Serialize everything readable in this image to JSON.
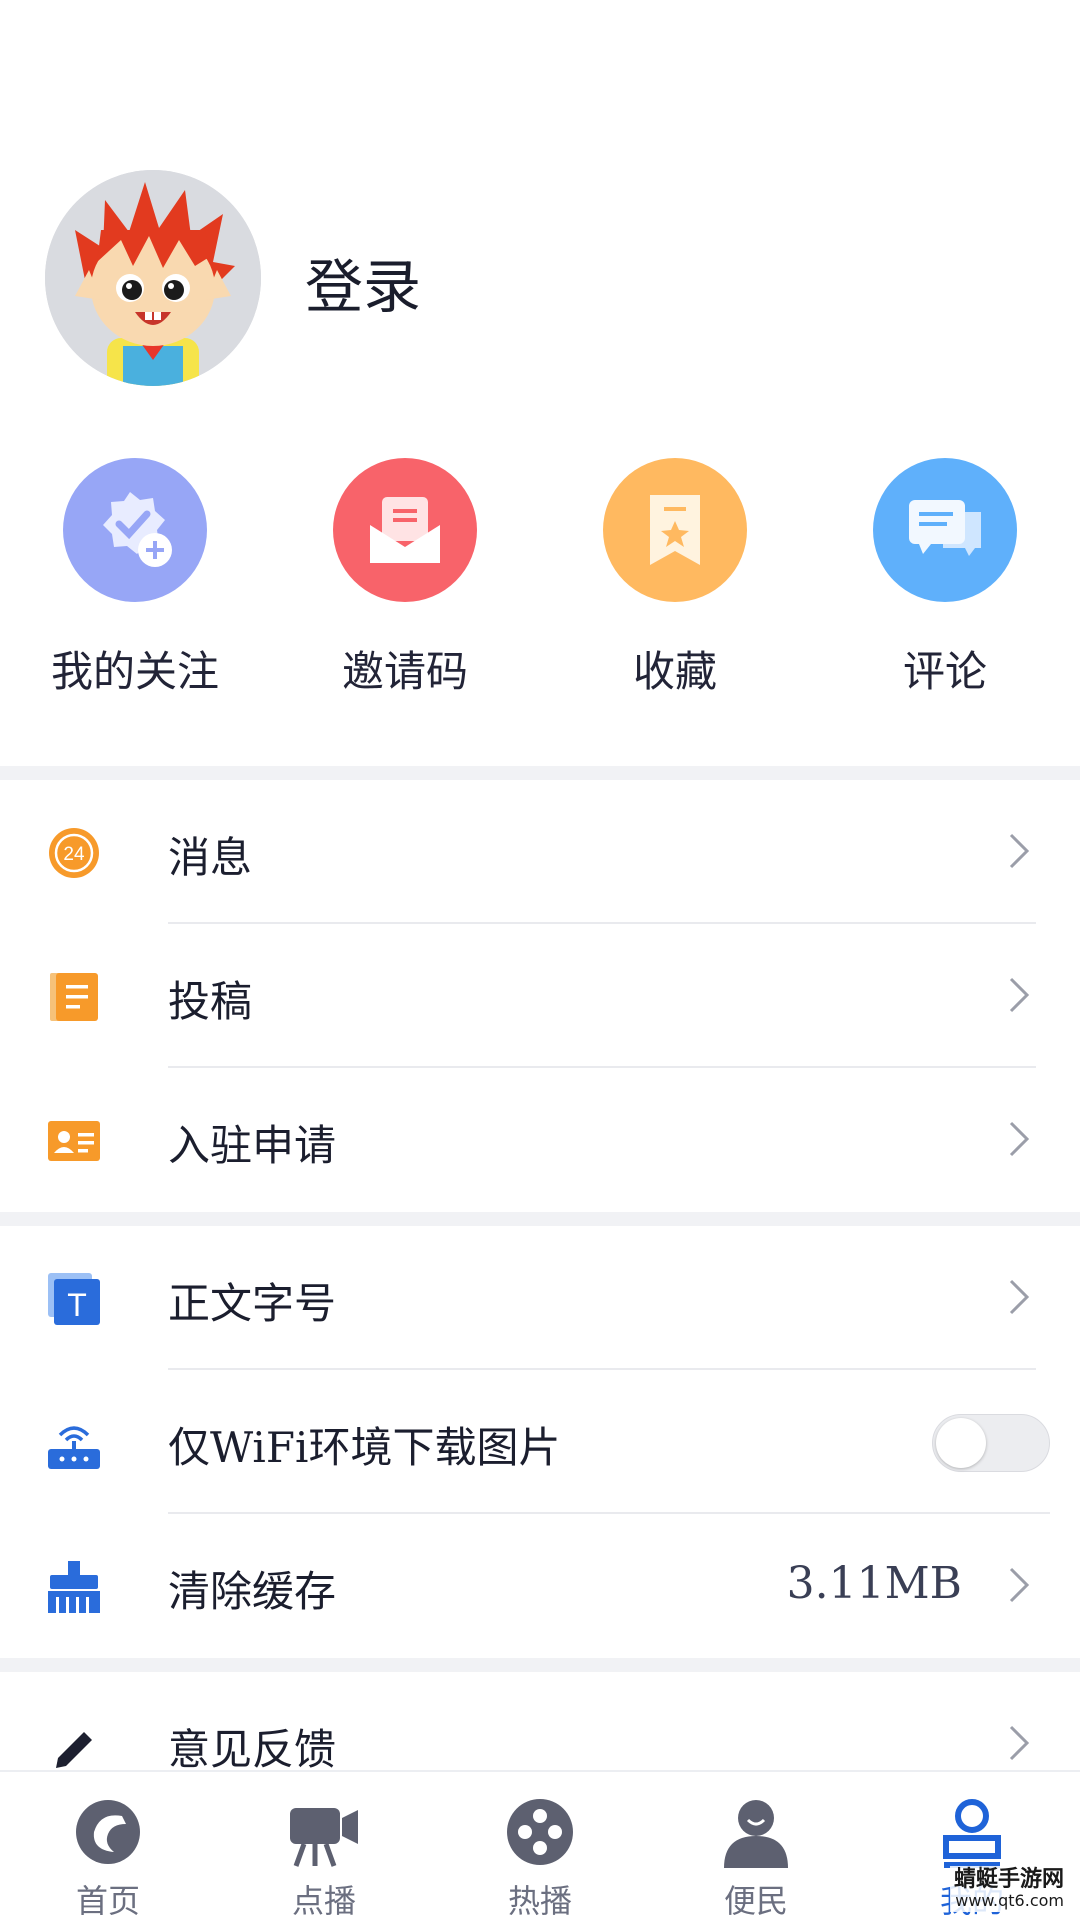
{
  "profile": {
    "login_label": "登录"
  },
  "quick_actions": [
    {
      "label": "我的关注",
      "icon": "follow-badge-icon",
      "color": "#97a6f6"
    },
    {
      "label": "邀请码",
      "icon": "envelope-icon",
      "color": "#f8636a"
    },
    {
      "label": "收藏",
      "icon": "bookmark-star-icon",
      "color": "#ffb960"
    },
    {
      "label": "评论",
      "icon": "chat-bubbles-icon",
      "color": "#5fb0fb"
    }
  ],
  "menu": {
    "messages": {
      "label": "消息",
      "icon": "24h-clock-icon",
      "badge": "24"
    },
    "submit": {
      "label": "投稿",
      "icon": "notebook-icon"
    },
    "settle": {
      "label": "入驻申请",
      "icon": "id-card-icon"
    },
    "font_size": {
      "label": "正文字号",
      "icon": "text-size-icon",
      "glyph": "T"
    },
    "wifi_images": {
      "label": "仅WiFi环境下载图片",
      "icon": "router-icon",
      "enabled": false
    },
    "clear_cache": {
      "label": "清除缓存",
      "icon": "broom-icon",
      "value": "3.11MB"
    },
    "feedback": {
      "label": "意见反馈",
      "icon": "pencil-icon"
    }
  },
  "tabs": [
    {
      "label": "首页",
      "icon": "home-logo-icon",
      "active": false
    },
    {
      "label": "点播",
      "icon": "video-camera-icon",
      "active": false
    },
    {
      "label": "热播",
      "icon": "film-reel-icon",
      "active": false
    },
    {
      "label": "便民",
      "icon": "person-icon",
      "active": false
    },
    {
      "label": "我的",
      "icon": "user-profile-icon",
      "active": true
    }
  ],
  "watermark": {
    "title": "蜻蜓手游网",
    "url": "www.qt6.com"
  },
  "colors": {
    "accent": "#1f63d8",
    "orange": "#f79a2a",
    "blue": "#2a6cdb"
  }
}
